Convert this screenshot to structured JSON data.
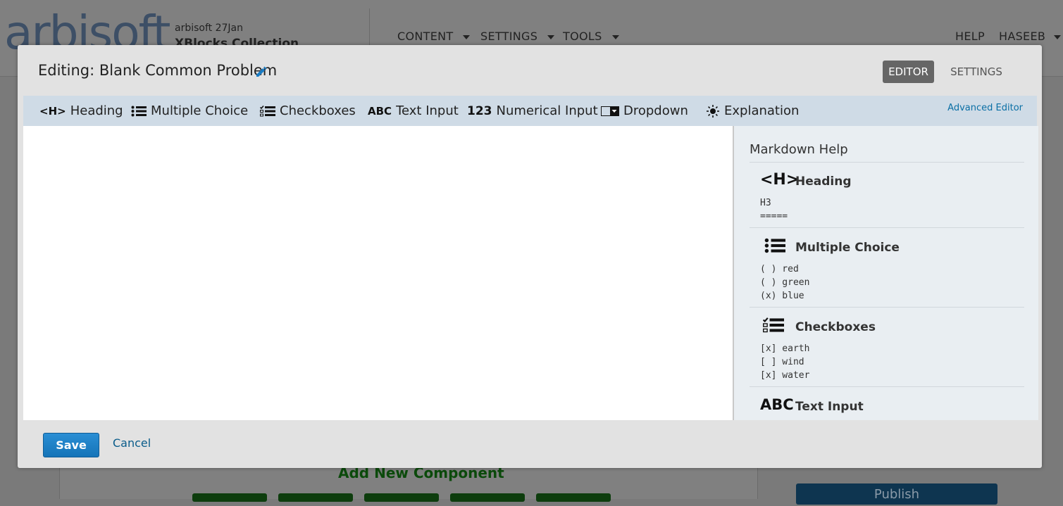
{
  "background": {
    "logo": "arbisoft",
    "course_org": "arbisoft  27Jan",
    "course_title": "XBlocks Collection",
    "nav": [
      "CONTENT",
      "SETTINGS",
      "TOOLS"
    ],
    "nav_right": [
      "HELP",
      "HASEEB"
    ],
    "add_component": "Add New Component",
    "publish": "Publish"
  },
  "modal": {
    "title": "Editing: Blank Common Problem",
    "modes": {
      "editor": "EDITOR",
      "settings": "SETTINGS"
    },
    "toolbar": {
      "items": [
        {
          "icon": "heading-icon",
          "icon_text": "<H>",
          "label": "Heading"
        },
        {
          "icon": "list-icon",
          "label": "Multiple Choice"
        },
        {
          "icon": "checklist-icon",
          "label": "Checkboxes"
        },
        {
          "icon": "abc-icon",
          "icon_text": "ABC",
          "label": "Text Input"
        },
        {
          "icon": "numbers-icon",
          "icon_text": "123",
          "label": "Numerical Input"
        },
        {
          "icon": "dropdown-icon",
          "label": "Dropdown"
        },
        {
          "icon": "lightbulb-icon",
          "label": "Explanation"
        }
      ],
      "advanced": "Advanced Editor"
    },
    "editor_content": "",
    "help": {
      "title": "Markdown Help",
      "sections": [
        {
          "icon": "heading-icon",
          "icon_text": "<H>",
          "name": "Heading",
          "code": "H3\n====="
        },
        {
          "icon": "list-icon",
          "name": "Multiple Choice",
          "code": "( ) red\n( ) green\n(x) blue"
        },
        {
          "icon": "checklist-icon",
          "name": "Checkboxes",
          "code": "[x] earth\n[ ] wind\n[x] water"
        },
        {
          "icon": "abc-icon",
          "icon_text": "ABC",
          "name": "Text Input",
          "code": ""
        }
      ]
    },
    "footer": {
      "save": "Save",
      "cancel": "Cancel"
    }
  },
  "colors": {
    "accent": "#1574b8",
    "toolbar": "#cfdbe6",
    "link": "#0a6fa5"
  }
}
